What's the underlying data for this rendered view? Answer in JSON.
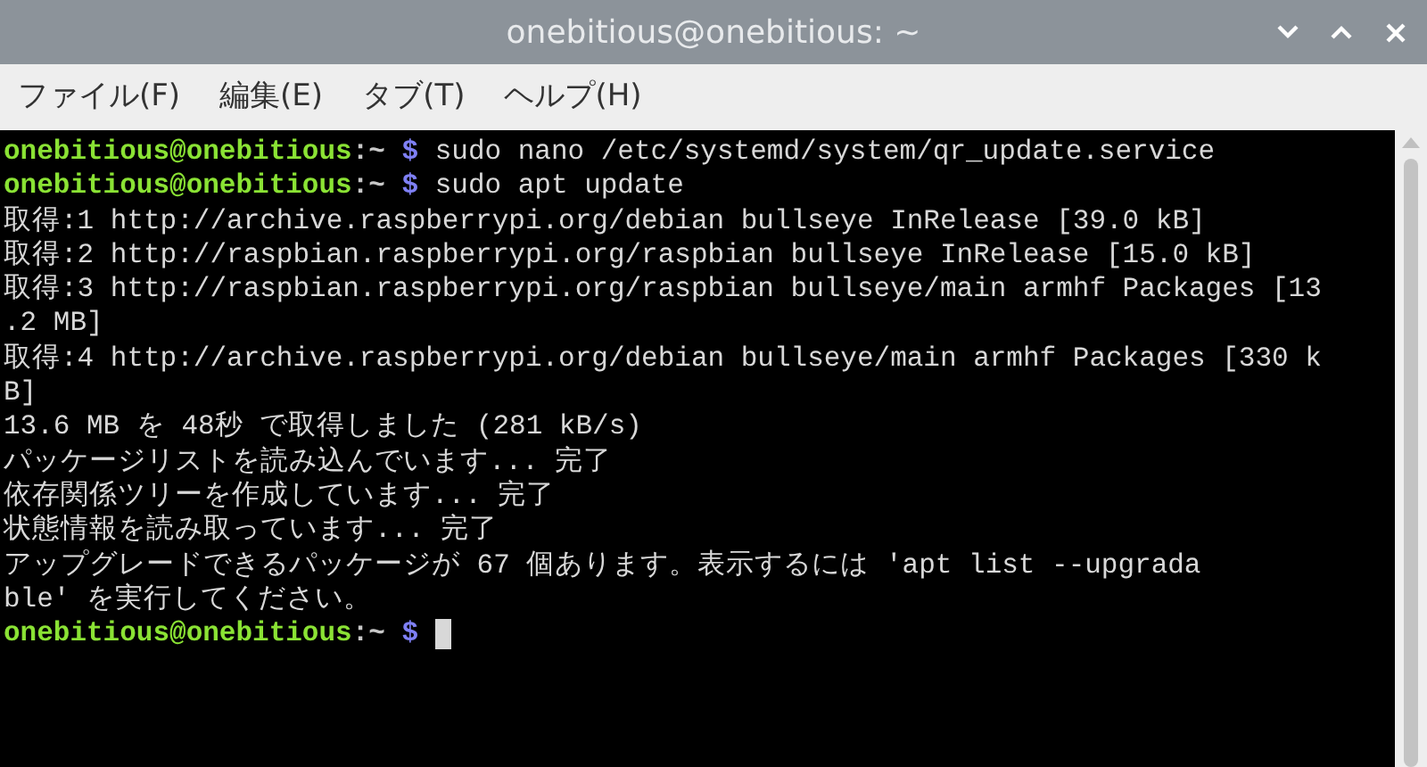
{
  "window": {
    "title": "onebitious@onebitious: ~"
  },
  "menu": [
    {
      "label": "ファイル(F)"
    },
    {
      "label": "編集(E)"
    },
    {
      "label": "タブ(T)"
    },
    {
      "label": "ヘルプ(H)"
    }
  ],
  "terminal": {
    "lines": [
      {
        "kind": "prompt",
        "user": "onebitious@onebitious",
        "path": ":~",
        "symbol": "$",
        "command": "sudo nano /etc/systemd/system/qr_update.service",
        "cursor": false
      },
      {
        "kind": "prompt",
        "user": "onebitious@onebitious",
        "path": ":~",
        "symbol": "$",
        "command": "sudo apt update",
        "cursor": false
      },
      {
        "kind": "output",
        "text": "取得:1 http://archive.raspberrypi.org/debian bullseye InRelease [39.0 kB]"
      },
      {
        "kind": "output",
        "text": "取得:2 http://raspbian.raspberrypi.org/raspbian bullseye InRelease [15.0 kB]"
      },
      {
        "kind": "output",
        "text": "取得:3 http://raspbian.raspberrypi.org/raspbian bullseye/main armhf Packages [13"
      },
      {
        "kind": "output",
        "text": ".2 MB]"
      },
      {
        "kind": "output",
        "text": "取得:4 http://archive.raspberrypi.org/debian bullseye/main armhf Packages [330 k"
      },
      {
        "kind": "output",
        "text": "B]"
      },
      {
        "kind": "output",
        "text": "13.6 MB を 48秒 で取得しました (281 kB/s)"
      },
      {
        "kind": "output",
        "text": "パッケージリストを読み込んでいます... 完了"
      },
      {
        "kind": "output",
        "text": "依存関係ツリーを作成しています... 完了"
      },
      {
        "kind": "output",
        "text": "状態情報を読み取っています... 完了"
      },
      {
        "kind": "output",
        "text": "アップグレードできるパッケージが 67 個あります。表示するには 'apt list --upgrada"
      },
      {
        "kind": "output",
        "text": "ble' を実行してください。"
      },
      {
        "kind": "prompt",
        "user": "onebitious@onebitious",
        "path": ":~",
        "symbol": "$",
        "cursor": true
      }
    ]
  }
}
